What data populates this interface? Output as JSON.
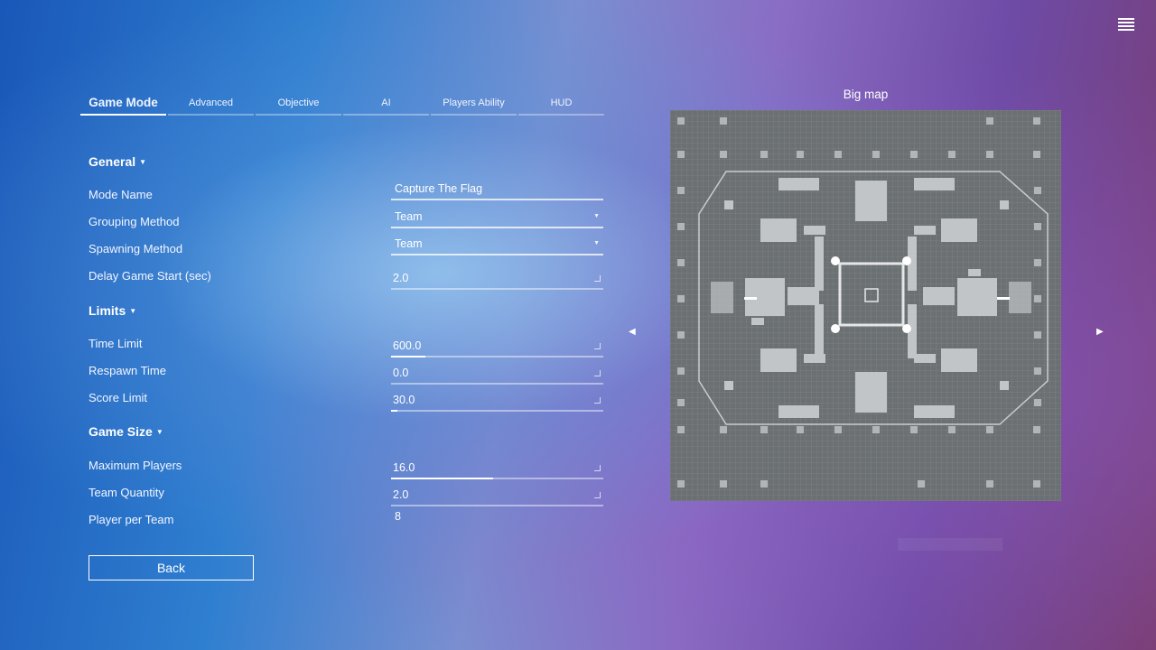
{
  "tabs": [
    {
      "label": "Game Mode",
      "active": true
    },
    {
      "label": "Advanced"
    },
    {
      "label": "Objective"
    },
    {
      "label": "AI"
    },
    {
      "label": "Players Ability"
    },
    {
      "label": "HUD"
    }
  ],
  "sections": {
    "general": "General",
    "limits": "Limits",
    "game_size": "Game Size"
  },
  "general": {
    "mode_name": {
      "label": "Mode Name",
      "value": "Capture The Flag"
    },
    "grouping_method": {
      "label": "Grouping Method",
      "value": "Team"
    },
    "spawning_method": {
      "label": "Spawning Method",
      "value": "Team"
    },
    "delay_game_start": {
      "label": "Delay Game Start (sec)",
      "value": "2.0"
    }
  },
  "limits": {
    "time_limit": {
      "label": "Time Limit",
      "value": "600.0",
      "fill": 0.16
    },
    "respawn_time": {
      "label": "Respawn Time",
      "value": "0.0",
      "fill": 0.0
    },
    "score_limit": {
      "label": "Score Limit",
      "value": "30.0",
      "fill": 0.03
    }
  },
  "game_size": {
    "maximum_players": {
      "label": "Maximum Players",
      "value": "16.0",
      "fill": 0.48
    },
    "team_quantity": {
      "label": "Team Quantity",
      "value": "2.0",
      "fill": 0.0
    },
    "player_per_team": {
      "label": "Player per Team",
      "value": "8"
    }
  },
  "back_label": "Back",
  "map": {
    "title": "Big map"
  },
  "icons": {
    "menu": "hamburger-menu-icon",
    "prev": "arrow-left-icon",
    "next": "arrow-right-icon",
    "dropdown": "chevron-down-icon"
  }
}
